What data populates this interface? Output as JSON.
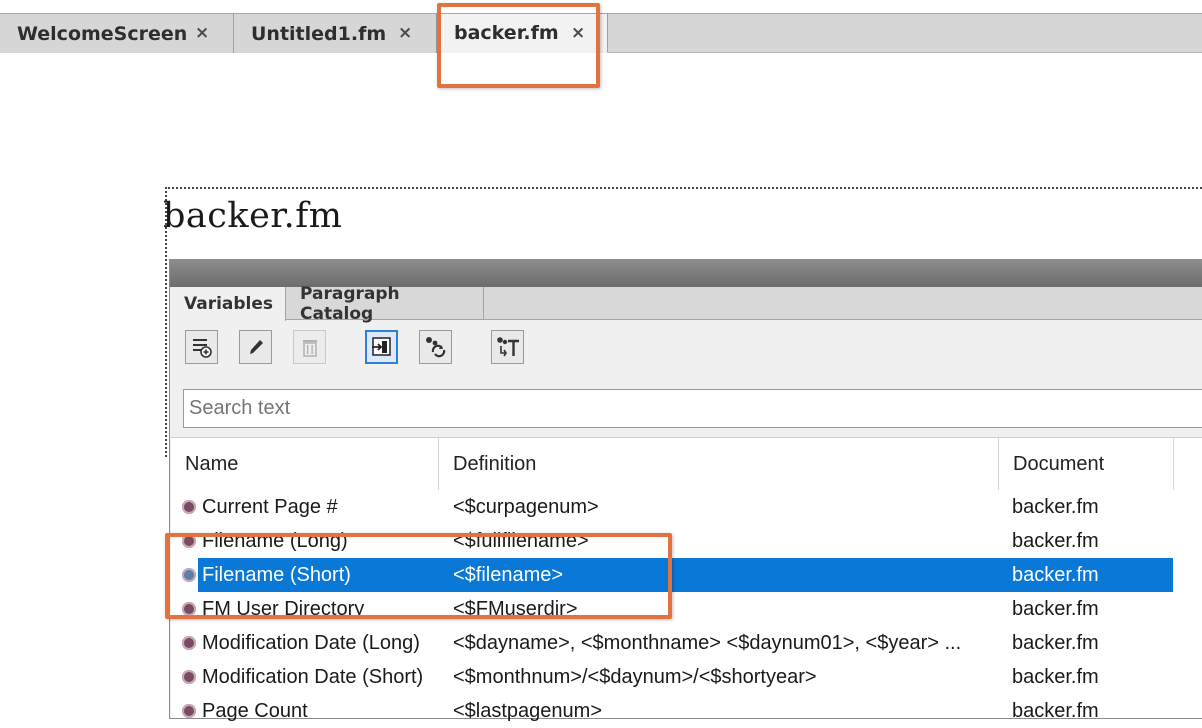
{
  "tabs": [
    {
      "label": "WelcomeScreen",
      "close": "×"
    },
    {
      "label": "Untitled1.fm",
      "close": "×"
    },
    {
      "label": "backer.fm",
      "close": "×"
    }
  ],
  "page": {
    "title": "backer.fm"
  },
  "pod": {
    "tabs": [
      "Variables",
      "Paragraph Catalog"
    ],
    "toolbar": [
      {
        "icon": "new-variable-icon"
      },
      {
        "icon": "edit-icon"
      },
      {
        "icon": "delete-icon"
      },
      {
        "icon": "insert-variable-icon"
      },
      {
        "icon": "update-variables-icon"
      },
      {
        "icon": "convert-to-text-icon"
      }
    ],
    "search_placeholder": "Search text",
    "columns": [
      "Name",
      "Definition",
      "Document"
    ],
    "rows": [
      {
        "name": "Current Page #",
        "definition": "<$curpagenum>",
        "document": "backer.fm"
      },
      {
        "name": "Filename (Long)",
        "definition": "<$fullfilename>",
        "document": "backer.fm"
      },
      {
        "name": "Filename (Short)",
        "definition": "<$filename>",
        "document": "backer.fm"
      },
      {
        "name": "FM User Directory",
        "definition": "<$FMuserdir>",
        "document": "backer.fm"
      },
      {
        "name": "Modification Date (Long)",
        "definition": "<$dayname>, <$monthname> <$daynum01>, <$year> ...",
        "document": "backer.fm"
      },
      {
        "name": "Modification Date (Short)",
        "definition": "<$monthnum>/<$daynum>/<$shortyear>",
        "document": "backer.fm"
      },
      {
        "name": "Page Count",
        "definition": "<$lastpagenum>",
        "document": "backer.fm"
      }
    ],
    "selected_row": "Filename (Short)"
  },
  "colors": {
    "highlight": "#e0733e",
    "selection": "#0a78d7"
  }
}
